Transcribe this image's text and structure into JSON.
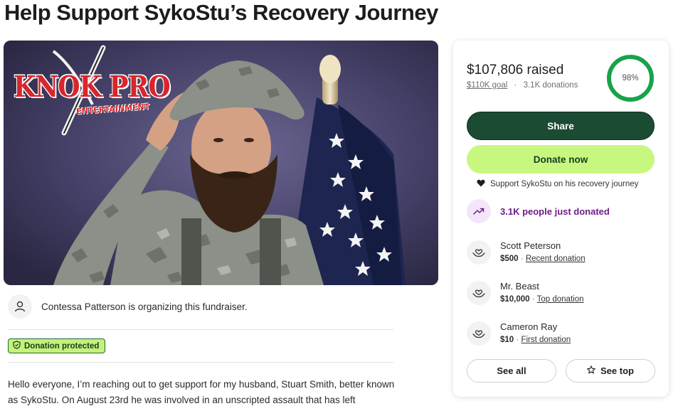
{
  "page": {
    "title": "Help Support SykoStu’s Recovery Journey"
  },
  "hero": {
    "logo_text": "KNOK PRO",
    "logo_subtext": "ENTERTAINMENT"
  },
  "organizer": {
    "text": "Contessa Patterson is organizing this fundraiser."
  },
  "badge": {
    "label": "Donation protected"
  },
  "story": {
    "text": "Hello everyone, I’m reaching out to get support for my husband, Stuart Smith, better known as SykoStu. On August 23rd he was involved in an unscripted assault that has left"
  },
  "card": {
    "raised": "$107,806 raised",
    "goal": "$110K goal",
    "separator": "·",
    "donations": "3.1K donations",
    "progress_percent": 98,
    "progress_label": "98%",
    "share_label": "Share",
    "donate_label": "Donate now",
    "support_text": "Support SykoStu on his recovery journey",
    "trending_text": "3.1K people just donated",
    "donors": [
      {
        "name": "Scott Peterson",
        "amount": "$500",
        "sep": "·",
        "kind": "Recent donation"
      },
      {
        "name": "Mr. Beast",
        "amount": "$10,000",
        "sep": "·",
        "kind": "Top donation"
      },
      {
        "name": "Cameron Ray",
        "amount": "$10",
        "sep": "·",
        "kind": "First donation"
      }
    ],
    "see_all_label": "See all",
    "see_top_label": "See top"
  },
  "colors": {
    "brand_green": "#1c4b33",
    "accent_lime": "#c8f77f",
    "progress_green": "#17a34a",
    "trending_purple": "#6f1c8a"
  }
}
